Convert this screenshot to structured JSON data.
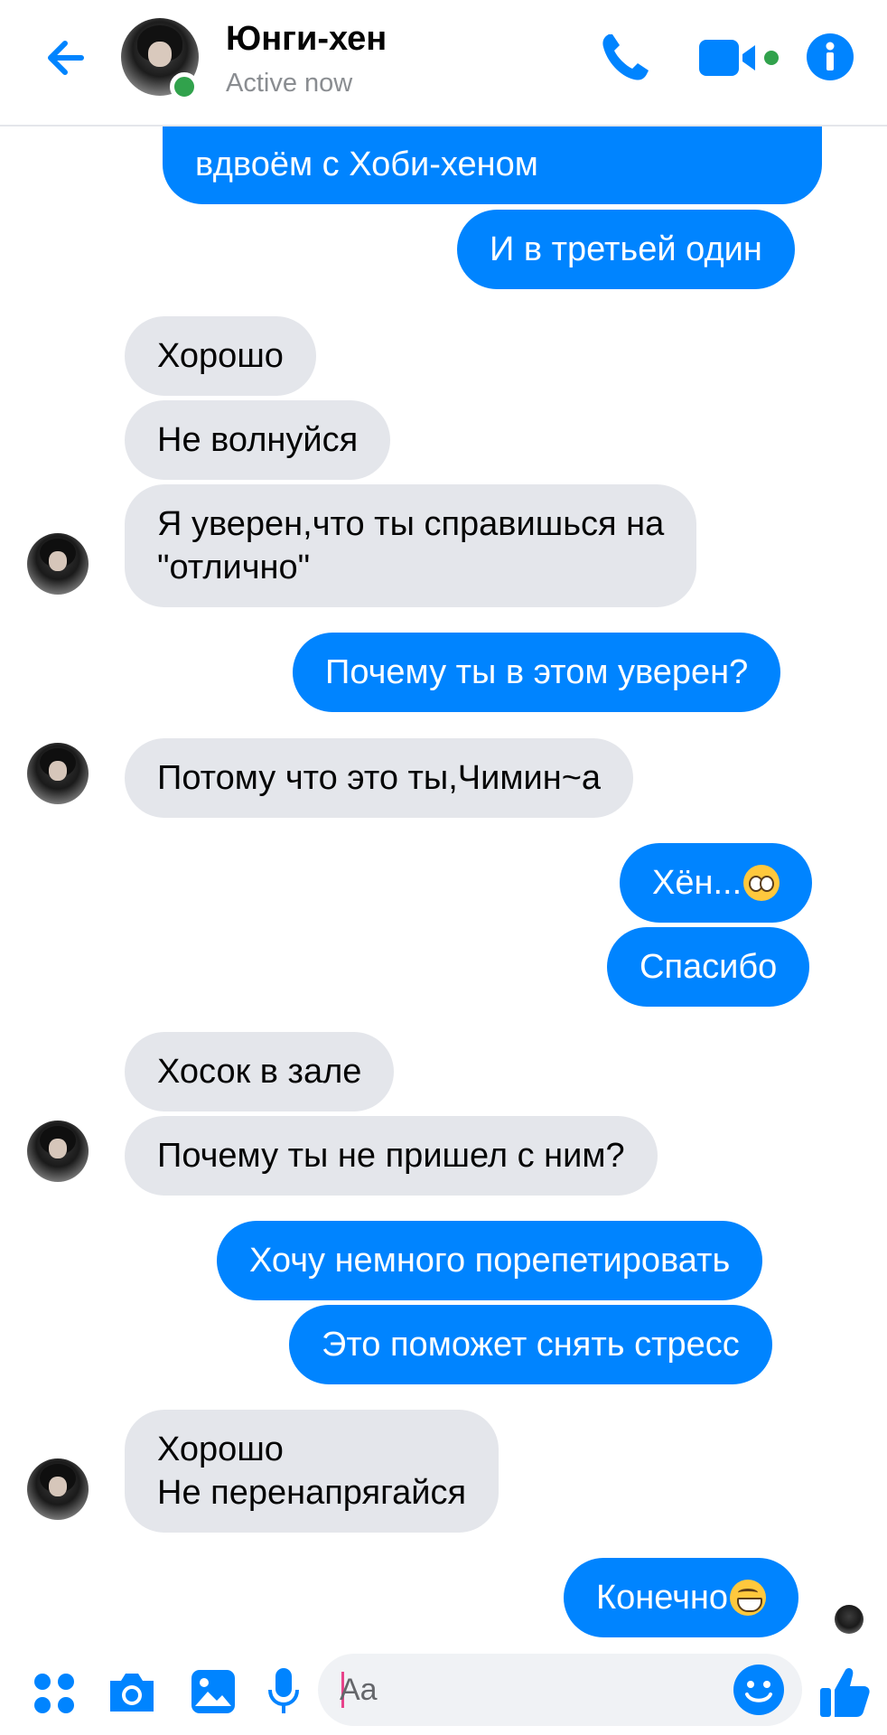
{
  "header": {
    "contact_name": "Юнги-хен",
    "status": "Active now",
    "accent_color": "#0084ff",
    "online_color": "#31a24c",
    "icons": [
      "back-arrow-icon",
      "phone-icon",
      "video-camera-icon",
      "info-icon"
    ]
  },
  "messages": {
    "m1": "вдвоём с Хоби-хеном",
    "m2": "И в третьей один",
    "m3": "Хорошо",
    "m4": "Не волнуйся",
    "m5": "Я уверен,что ты справишься на\n\"отлично\"",
    "m6": "Почему ты в этом уверен?",
    "m7": "Потому что это ты,Чимин~а",
    "m8": "Хён...",
    "m9": "Спасибо",
    "m10": "Хосок в зале",
    "m11": "Почему ты не пришел с ним?",
    "m12": "Хочу немного порепетировать",
    "m13": "Это поможет снять стресс",
    "m14": "Хорошо\nНе перенапрягайся",
    "m15": "Конечно"
  },
  "emojis": {
    "m8": "pleading-face-emoji",
    "m15": "grinning-face-emoji"
  },
  "bubble_colors": {
    "outgoing": "#0084ff",
    "incoming": "#e4e6eb"
  },
  "composer": {
    "placeholder": "Aa",
    "icons": [
      "apps-icon",
      "camera-icon",
      "gallery-icon",
      "microphone-icon",
      "emoji-icon",
      "thumbs-up-icon"
    ]
  }
}
